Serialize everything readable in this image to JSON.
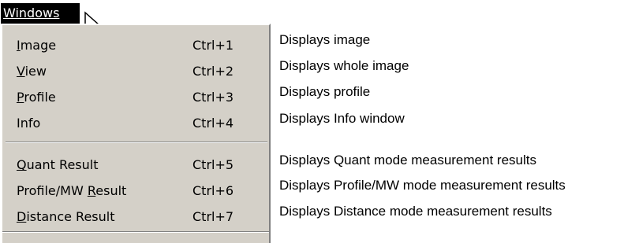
{
  "menu": {
    "title": "Windows",
    "items": [
      {
        "label_pre": "",
        "accel": "I",
        "label_post": "mage",
        "shortcut": "Ctrl+1",
        "description": "Displays image"
      },
      {
        "label_pre": "",
        "accel": "V",
        "label_post": "iew",
        "shortcut": "Ctrl+2",
        "description": "Displays whole image"
      },
      {
        "label_pre": "",
        "accel": "P",
        "label_post": "rofile",
        "shortcut": "Ctrl+3",
        "description": "Displays profile"
      },
      {
        "label_pre": "Info",
        "accel": "",
        "label_post": "",
        "shortcut": "Ctrl+4",
        "description": "Displays Info window"
      },
      {
        "label_pre": "",
        "accel": "Q",
        "label_post": "uant Result",
        "shortcut": "Ctrl+5",
        "description": "Displays Quant mode measurement results"
      },
      {
        "label_pre": "Profile/MW ",
        "accel": "R",
        "label_post": "esult",
        "shortcut": "Ctrl+6",
        "description": "Displays Profile/MW mode measurement results"
      },
      {
        "label_pre": "",
        "accel": "D",
        "label_post": "istance Result",
        "shortcut": "Ctrl+7",
        "description": "Displays Distance mode measurement results"
      }
    ]
  },
  "icons": {
    "cursor": "mouse-pointer-icon"
  },
  "colors": {
    "menu_background": "#d4d0c8",
    "title_background": "#000000",
    "title_text": "#ffffff"
  }
}
